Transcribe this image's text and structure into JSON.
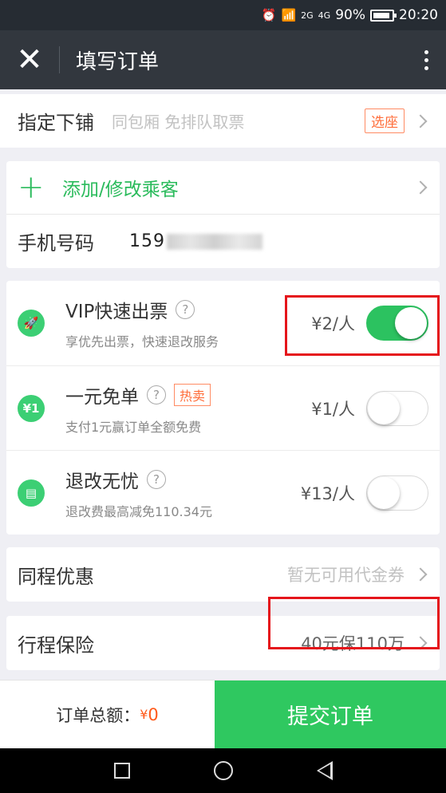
{
  "status_bar": {
    "alarm": "⏰",
    "wifi": "📶",
    "signal_2g": "2G",
    "signal_4g": "4G",
    "battery_pct": "90%",
    "time": "20:20"
  },
  "nav": {
    "title": "填写订单",
    "close": "✕"
  },
  "berth": {
    "label": "指定下铺",
    "hint": "同包厢 免排队取票",
    "tag": "选座"
  },
  "passenger": {
    "add_label": "添加/修改乘客",
    "phone_label": "手机号码",
    "phone_prefix": "159"
  },
  "services": [
    {
      "icon": "🚀",
      "title": "VIP快速出票",
      "desc": "享优先出票，快速退改服务",
      "price": "¥2/人",
      "on": true
    },
    {
      "icon": "¥1",
      "title": "一元免单",
      "hot": "热卖",
      "desc": "支付1元赢订单全额免费",
      "price": "¥1/人",
      "on": false
    },
    {
      "icon": "▤",
      "title": "退改无忧",
      "desc": "退改费最高减免110.34元",
      "price": "¥13/人",
      "on": false
    }
  ],
  "qmark": "?",
  "coupon": {
    "label": "同程优惠",
    "value": "暂无可用代金券"
  },
  "insurance": {
    "label": "行程保险",
    "value": "40元保110万"
  },
  "footer": {
    "total_label": "订单总额：",
    "currency": "¥",
    "total_value": "0",
    "submit": "提交订单"
  }
}
